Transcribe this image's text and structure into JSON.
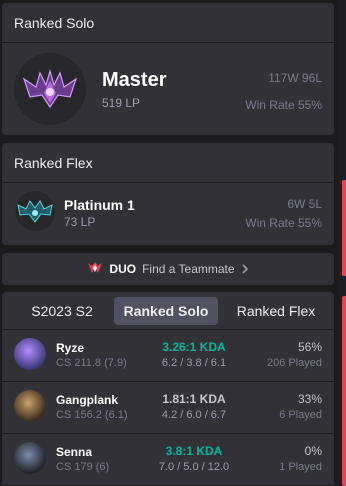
{
  "colors": {
    "background": "#1c1c1f",
    "card": "#313137",
    "accent_red": "#e84057",
    "kda_teal": "#00bba3",
    "kda_default": "#9e9eb1",
    "active_tab": "#515163"
  },
  "ranked_solo": {
    "header": "Ranked Solo",
    "tier": "Master",
    "lp": "519 LP",
    "record": "117W 96L",
    "win_rate": "Win Rate 55%",
    "emblem_icon": "master-emblem-icon"
  },
  "ranked_flex": {
    "header": "Ranked Flex",
    "tier": "Platinum 1",
    "lp": "73 LP",
    "record": "6W 5L",
    "win_rate": "Win Rate 55%",
    "emblem_icon": "platinum-emblem-icon"
  },
  "duo": {
    "label": "DUO",
    "text": "Find a Teammate",
    "icon": "duo-logo-icon"
  },
  "champion_stats": {
    "tabs": [
      {
        "label": "S2023 S2",
        "active": false
      },
      {
        "label": "Ranked Solo",
        "active": true
      },
      {
        "label": "Ranked Flex",
        "active": false
      }
    ],
    "rows": [
      {
        "name": "Ryze",
        "cs": "CS 211.8 (7.9)",
        "kda": "3.26:1 KDA",
        "kda_detail": "6.2 / 3.8 / 6.1",
        "win_rate": "56%",
        "played": "206 Played",
        "kda_color": "#00bba3",
        "avatar": [
          "#3d3a7a",
          "#b68bff"
        ]
      },
      {
        "name": "Gangplank",
        "cs": "CS 156.2 (6.1)",
        "kda": "1.81:1 KDA",
        "kda_detail": "4.2 / 6.0 / 6.7",
        "win_rate": "33%",
        "played": "6 Played",
        "kda_color": "#c6c6cf",
        "avatar": [
          "#3a2d1f",
          "#c9a26a"
        ]
      },
      {
        "name": "Senna",
        "cs": "CS 179 (6)",
        "kda": "3.8:1 KDA",
        "kda_detail": "7.0 / 5.0 / 12.0",
        "win_rate": "0%",
        "played": "1 Played",
        "kda_color": "#00bba3",
        "avatar": [
          "#20242c",
          "#7b8ea8"
        ]
      }
    ]
  }
}
